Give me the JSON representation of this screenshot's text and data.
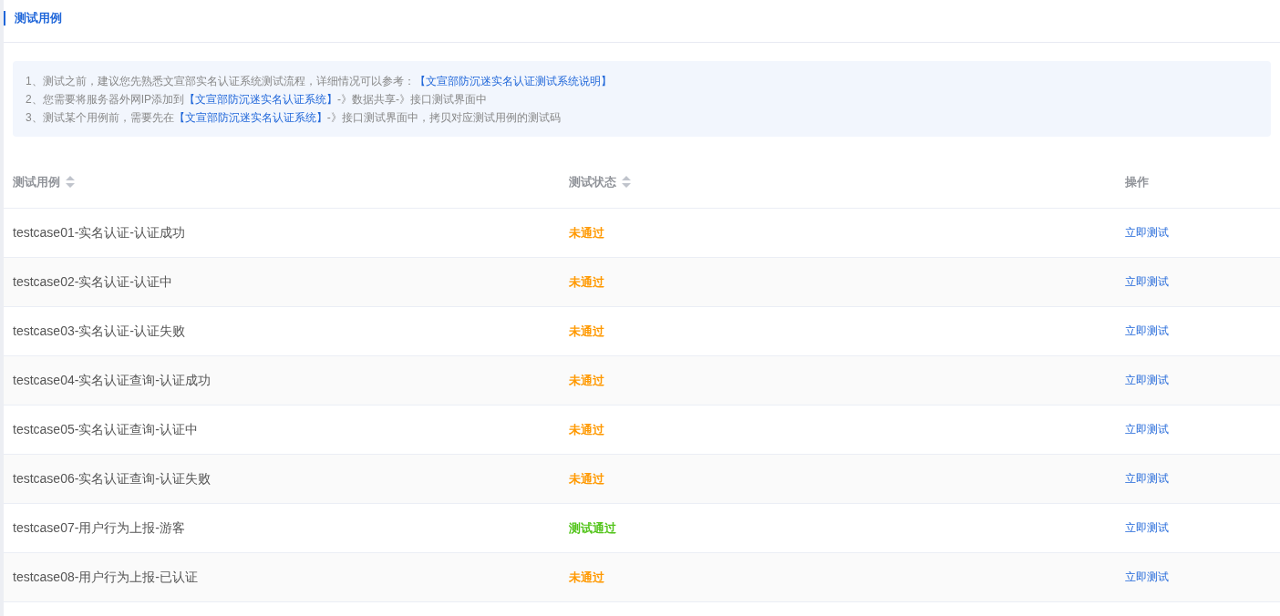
{
  "title": "测试用例",
  "notice": [
    {
      "parts": [
        {
          "kind": "text",
          "text": "1、测试之前，建议您先熟悉文宣部实名认证系统测试流程，详细情况可以参考："
        },
        {
          "kind": "link",
          "text": "【文宣部防沉迷实名认证测试系统说明】"
        }
      ]
    },
    {
      "parts": [
        {
          "kind": "text",
          "text": "2、您需要将服务器外网IP添加到"
        },
        {
          "kind": "link",
          "text": "【文宣部防沉迷实名认证系统】"
        },
        {
          "kind": "text",
          "text": "-》数据共享-》接口测试界面中"
        }
      ]
    },
    {
      "parts": [
        {
          "kind": "text",
          "text": "3、测试某个用例前，需要先在"
        },
        {
          "kind": "link",
          "text": "【文宣部防沉迷实名认证系统】"
        },
        {
          "kind": "text",
          "text": "-》接口测试界面中，拷贝对应测试用例的测试码"
        }
      ]
    }
  ],
  "table": {
    "columns": [
      {
        "label": "测试用例",
        "sortable": true
      },
      {
        "label": "测试状态",
        "sortable": true
      },
      {
        "label": "操作",
        "sortable": false
      }
    ],
    "rows": [
      {
        "name": "testcase01-实名认证-认证成功",
        "status": "未通过",
        "kind": "fail",
        "action": "立即测试"
      },
      {
        "name": "testcase02-实名认证-认证中",
        "status": "未通过",
        "kind": "fail",
        "action": "立即测试"
      },
      {
        "name": "testcase03-实名认证-认证失败",
        "status": "未通过",
        "kind": "fail",
        "action": "立即测试"
      },
      {
        "name": "testcase04-实名认证查询-认证成功",
        "status": "未通过",
        "kind": "fail",
        "action": "立即测试"
      },
      {
        "name": "testcase05-实名认证查询-认证中",
        "status": "未通过",
        "kind": "fail",
        "action": "立即测试"
      },
      {
        "name": "testcase06-实名认证查询-认证失败",
        "status": "未通过",
        "kind": "fail",
        "action": "立即测试"
      },
      {
        "name": "testcase07-用户行为上报-游客",
        "status": "测试通过",
        "kind": "pass",
        "action": "立即测试"
      },
      {
        "name": "testcase08-用户行为上报-已认证",
        "status": "未通过",
        "kind": "fail",
        "action": "立即测试"
      }
    ]
  }
}
